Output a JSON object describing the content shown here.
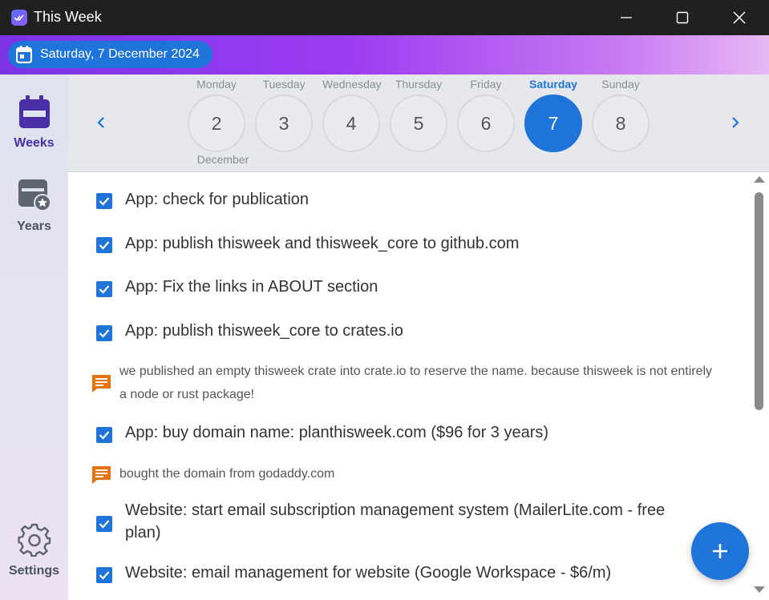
{
  "window": {
    "title": "This Week",
    "minimize_icon": "minimize-icon",
    "maximize_icon": "maximize-icon",
    "close_icon": "close-icon"
  },
  "banner": {
    "date_label": "Saturday, 7 December 2024",
    "icon": "calendar-icon",
    "pill_color": "#1e74d8"
  },
  "sidebar": {
    "items": [
      {
        "label": "Weeks",
        "icon": "calendar-icon",
        "active": true
      },
      {
        "label": "Years",
        "icon": "calendar-star-icon",
        "active": false
      },
      {
        "label": "Settings",
        "icon": "gear-icon",
        "active": false
      }
    ]
  },
  "week": {
    "month": "December",
    "days": [
      {
        "name": "Monday",
        "number": "2"
      },
      {
        "name": "Tuesday",
        "number": "3"
      },
      {
        "name": "Wednesday",
        "number": "4"
      },
      {
        "name": "Thursday",
        "number": "5"
      },
      {
        "name": "Friday",
        "number": "6"
      },
      {
        "name": "Saturday",
        "number": "7",
        "selected": true
      },
      {
        "name": "Sunday",
        "number": "8"
      }
    ],
    "selected_color": "#1e74d8"
  },
  "tasks": [
    {
      "type": "task",
      "checked": true,
      "text": "App: check for publication"
    },
    {
      "type": "task",
      "checked": true,
      "text": "App: publish thisweek and thisweek_core to github.com"
    },
    {
      "type": "task",
      "checked": true,
      "text": "App: Fix the links in ABOUT section"
    },
    {
      "type": "task",
      "checked": true,
      "text": "App: publish thisweek_core to crates.io"
    },
    {
      "type": "note",
      "text": "we published an empty thisweek crate into crate.io to reserve the name. because thisweek is not entirely a node or rust package!"
    },
    {
      "type": "task",
      "checked": true,
      "text": "App: buy domain name: planthisweek.com ($96 for 3 years)"
    },
    {
      "type": "note",
      "text": "bought the domain from godaddy.com"
    },
    {
      "type": "task",
      "checked": true,
      "text": "Website: start email subscription management system (MailerLite.com - free plan)"
    },
    {
      "type": "task",
      "checked": true,
      "text": "Website: email management for website (Google Workspace - $6/m)"
    }
  ],
  "note_color": "#e8720c",
  "fab": {
    "icon": "plus-icon"
  }
}
